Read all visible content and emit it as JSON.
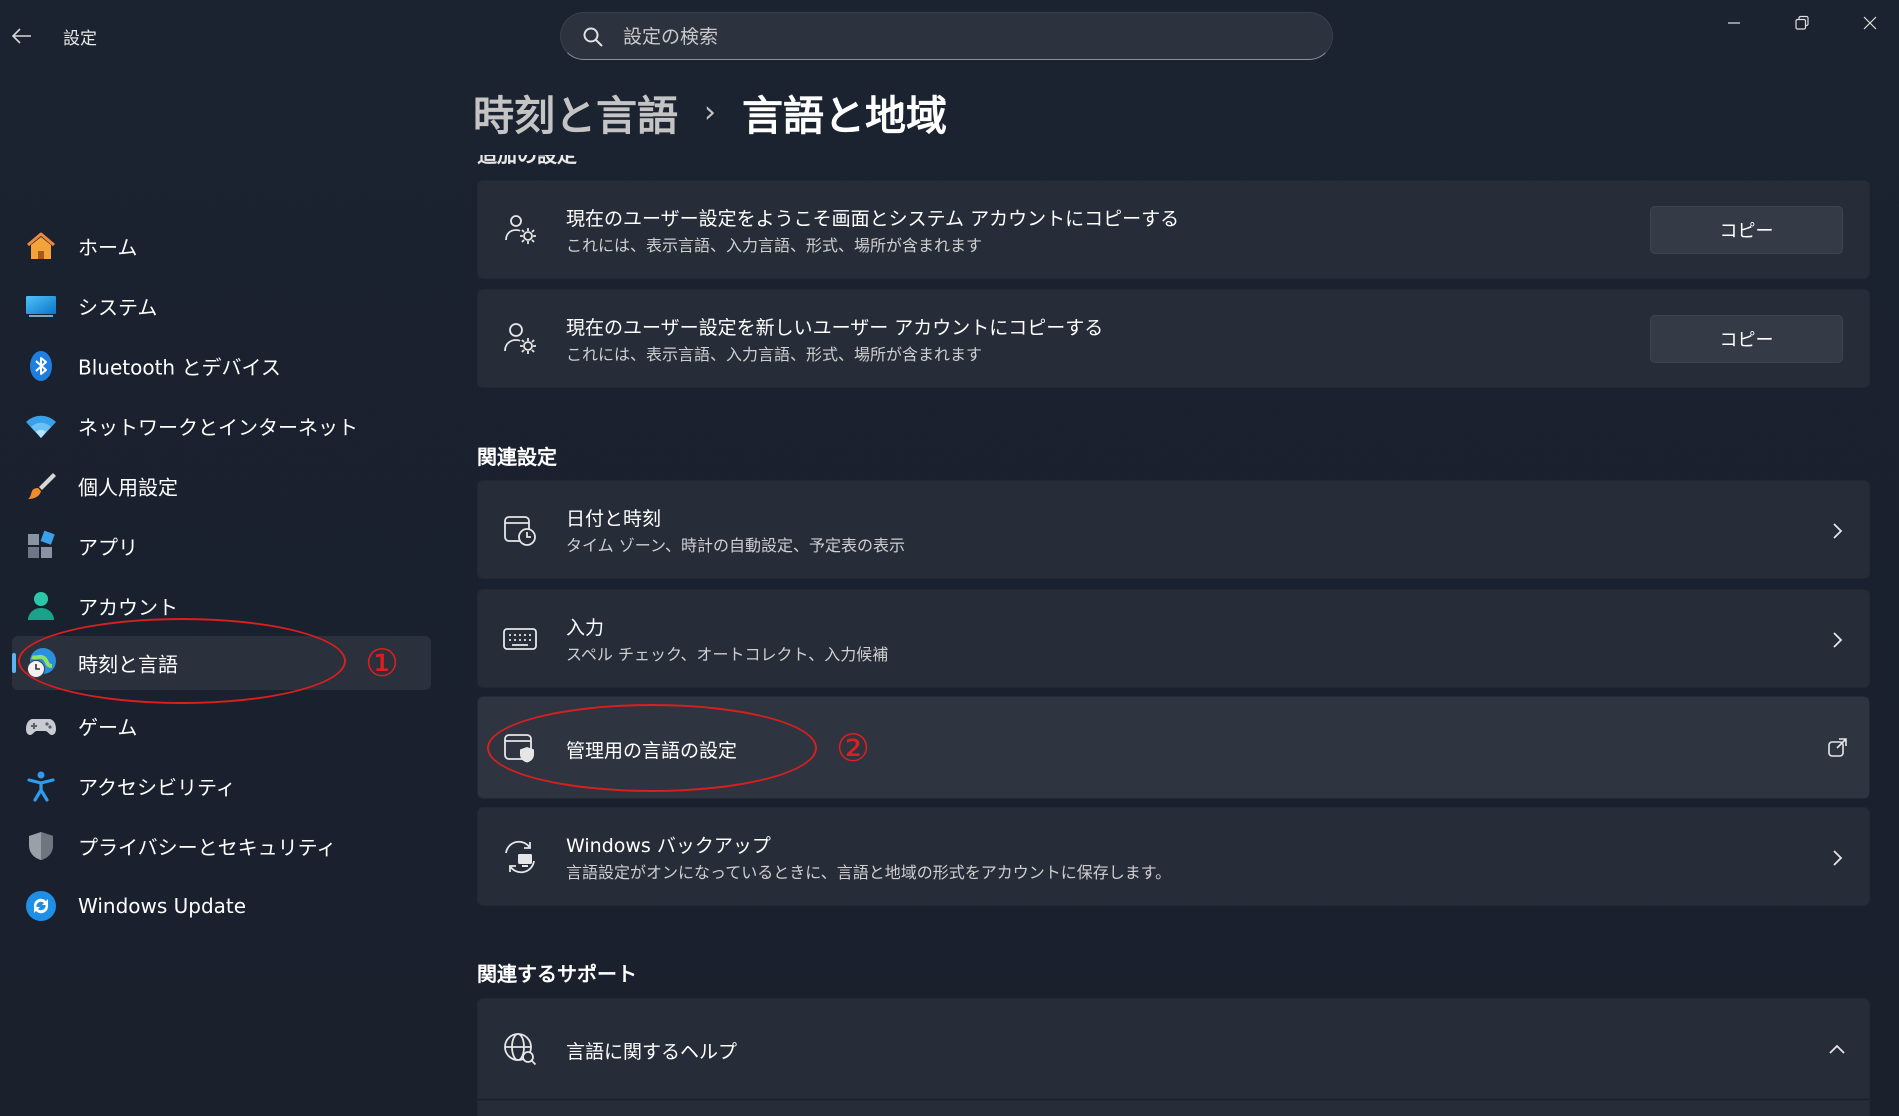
{
  "app": {
    "title": "設定"
  },
  "search": {
    "placeholder": "設定の検索"
  },
  "window_controls": {
    "minimize": "minimize",
    "maximize": "maximize",
    "close": "close"
  },
  "sidebar": {
    "items": [
      {
        "label": "ホーム",
        "icon": "home-icon"
      },
      {
        "label": "システム",
        "icon": "monitor-icon"
      },
      {
        "label": "Bluetooth とデバイス",
        "icon": "bluetooth-icon"
      },
      {
        "label": "ネットワークとインターネット",
        "icon": "wifi-icon"
      },
      {
        "label": "個人用設定",
        "icon": "brush-icon"
      },
      {
        "label": "アプリ",
        "icon": "apps-icon"
      },
      {
        "label": "アカウント",
        "icon": "account-icon"
      },
      {
        "label": "時刻と言語",
        "icon": "time-language-icon",
        "active": true
      },
      {
        "label": "ゲーム",
        "icon": "gamepad-icon"
      },
      {
        "label": "アクセシビリティ",
        "icon": "accessibility-icon"
      },
      {
        "label": "プライバシーとセキュリティ",
        "icon": "shield-icon"
      },
      {
        "label": "Windows Update",
        "icon": "update-icon"
      }
    ]
  },
  "breadcrumb": {
    "parent": "時刻と言語",
    "separator": "›",
    "current": "言語と地域"
  },
  "sections": {
    "admin_section_cut": "追加の設定",
    "related_settings": "関連設定",
    "related_support": "関連するサポート"
  },
  "copy_cards": [
    {
      "title": "現在のユーザー設定をようこそ画面とシステム アカウントにコピーする",
      "subtitle": "これには、表示言語、入力言語、形式、場所が含まれます",
      "button": "コピー"
    },
    {
      "title": "現在のユーザー設定を新しいユーザー アカウントにコピーする",
      "subtitle": "これには、表示言語、入力言語、形式、場所が含まれます",
      "button": "コピー"
    }
  ],
  "related": [
    {
      "title": "日付と時刻",
      "subtitle": "タイム ゾーン、時計の自動設定、予定表の表示",
      "icon": "calendar-clock-icon",
      "action": "chevron-right-icon"
    },
    {
      "title": "入力",
      "subtitle": "スペル チェック、オートコレクト、入力候補",
      "icon": "keyboard-icon",
      "action": "chevron-right-icon"
    },
    {
      "title": "管理用の言語の設定",
      "subtitle": "",
      "icon": "admin-shield-icon",
      "action": "external-link-icon"
    },
    {
      "title": "Windows バックアップ",
      "subtitle": "言語設定がオンになっているときに、言語と地域の形式をアカウントに保存します。",
      "icon": "backup-sync-icon",
      "action": "chevron-right-icon"
    }
  ],
  "support": [
    {
      "title": "言語に関するヘルプ",
      "icon": "globe-search-icon",
      "action": "chevron-up-icon"
    }
  ],
  "annotations": [
    {
      "label": "①",
      "color": "#d91f1f"
    },
    {
      "label": "②",
      "color": "#d91f1f"
    }
  ]
}
